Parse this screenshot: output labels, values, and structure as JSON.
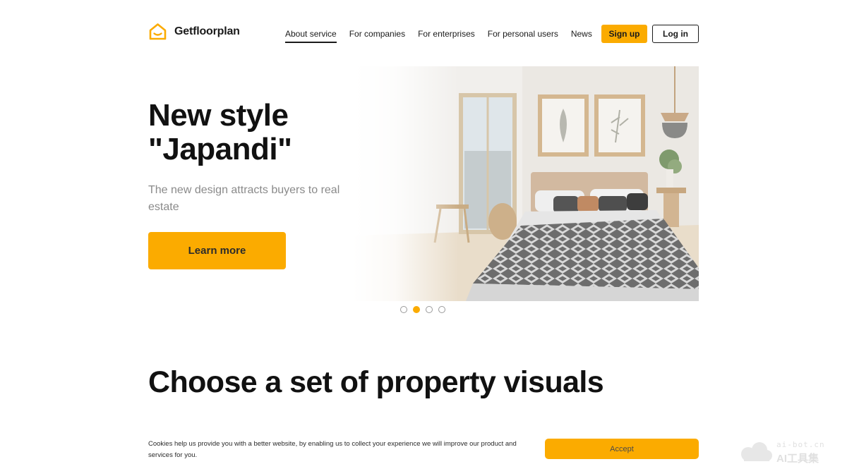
{
  "brand": {
    "name": "Getfloorplan",
    "accent": "#fbab00"
  },
  "nav": {
    "items": [
      {
        "label": "About service",
        "active": true
      },
      {
        "label": "For companies",
        "active": false
      },
      {
        "label": "For enterprises",
        "active": false
      },
      {
        "label": "For personal users",
        "active": false
      },
      {
        "label": "News",
        "active": false
      }
    ],
    "signup_label": "Sign up",
    "login_label": "Log in"
  },
  "hero": {
    "title_line1": "New style",
    "title_line2": "\"Japandi\"",
    "subtitle": "The new design attracts buyers to real estate",
    "cta_label": "Learn more",
    "image_icon": "bedroom-photo",
    "slides_total": 4,
    "active_slide": 2
  },
  "section": {
    "title": "Choose a set of property visuals"
  },
  "cookie": {
    "text": "Cookies help us provide you with a better website, by enabling us to collect your experience we will improve our product and services for you.",
    "accept_label": "Accept"
  },
  "watermark": {
    "line1": "ai-bot.cn",
    "line2": "AI工具集"
  }
}
